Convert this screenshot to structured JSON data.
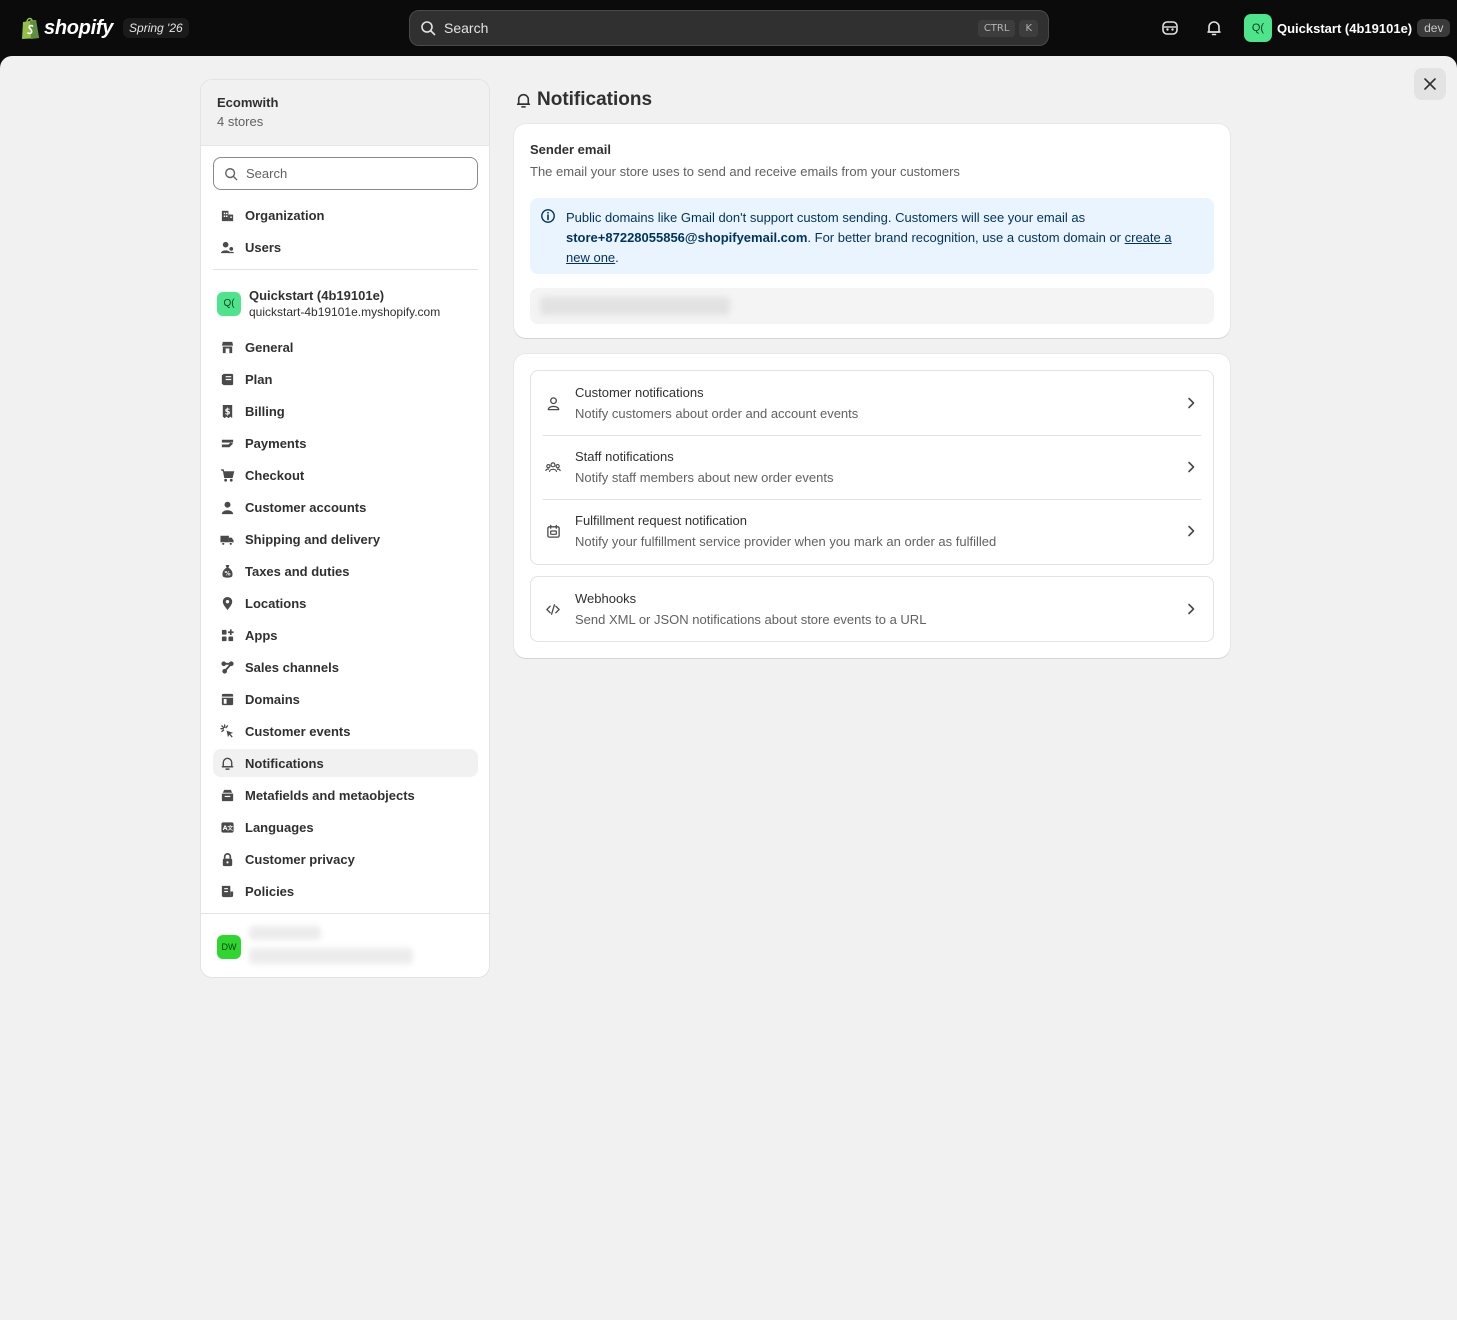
{
  "topbar": {
    "wordmark": "shopify",
    "edition": "Spring '26",
    "search_placeholder": "Search",
    "kbd_ctrl": "CTRL",
    "kbd_k": "K",
    "store_avatar": "Q(",
    "store_name": "Quickstart (4b19101e)",
    "store_badge": "dev"
  },
  "sidebar": {
    "org_name": "Ecomwith",
    "org_sub": "4 stores",
    "search_placeholder": "Search",
    "org_items": [
      {
        "label": "Organization",
        "icon": "organization-icon"
      },
      {
        "label": "Users",
        "icon": "users-icon"
      }
    ],
    "store": {
      "avatar": "Q(",
      "name": "Quickstart (4b19101e)",
      "domain": "quickstart-4b19101e.myshopify.com"
    },
    "items": [
      {
        "label": "General",
        "icon": "store-icon"
      },
      {
        "label": "Plan",
        "icon": "plan-icon"
      },
      {
        "label": "Billing",
        "icon": "billing-icon"
      },
      {
        "label": "Payments",
        "icon": "payments-icon"
      },
      {
        "label": "Checkout",
        "icon": "cart-icon"
      },
      {
        "label": "Customer accounts",
        "icon": "person-icon"
      },
      {
        "label": "Shipping and delivery",
        "icon": "truck-icon"
      },
      {
        "label": "Taxes and duties",
        "icon": "tax-icon"
      },
      {
        "label": "Locations",
        "icon": "location-icon"
      },
      {
        "label": "Apps",
        "icon": "apps-icon"
      },
      {
        "label": "Sales channels",
        "icon": "sales-channels-icon"
      },
      {
        "label": "Domains",
        "icon": "domains-icon"
      },
      {
        "label": "Customer events",
        "icon": "cursor-click-icon"
      },
      {
        "label": "Notifications",
        "icon": "bell-icon"
      },
      {
        "label": "Metafields and metaobjects",
        "icon": "metafields-icon"
      },
      {
        "label": "Languages",
        "icon": "language-icon"
      },
      {
        "label": "Customer privacy",
        "icon": "lock-icon"
      },
      {
        "label": "Policies",
        "icon": "policies-icon"
      }
    ],
    "active_item": "Notifications",
    "footer_avatar": "DW"
  },
  "page": {
    "title": "Notifications",
    "sender": {
      "heading": "Sender email",
      "description": "The email your store uses to send and receive emails from your customers",
      "banner_part1": "Public domains like Gmail don't support custom sending. Customers will see your email as ",
      "banner_email": "store+87228055856@shopifyemail.com",
      "banner_part2": ". For better brand recognition, use a custom domain or ",
      "banner_link": "create a new one",
      "banner_part3": "."
    },
    "notification_rows": [
      {
        "title": "Customer notifications",
        "description": "Notify customers about order and account events",
        "icon": "person-outline-icon"
      },
      {
        "title": "Staff notifications",
        "description": "Notify staff members about new order events",
        "icon": "team-icon"
      },
      {
        "title": "Fulfillment request notification",
        "description": "Notify your fulfillment service provider when you mark an order as fulfilled",
        "icon": "fulfillment-icon"
      }
    ],
    "webhooks_row": {
      "title": "Webhooks",
      "description": "Send XML or JSON notifications about store events to a URL",
      "icon": "code-icon"
    }
  },
  "colors": {
    "topbar_bg": "#0b0b0b",
    "surface_bg": "#f1f1f1",
    "store_avatar": "#4ee48b",
    "footer_avatar": "#2fd62f",
    "banner_bg": "#eaf4ff",
    "banner_text": "#00335c"
  }
}
